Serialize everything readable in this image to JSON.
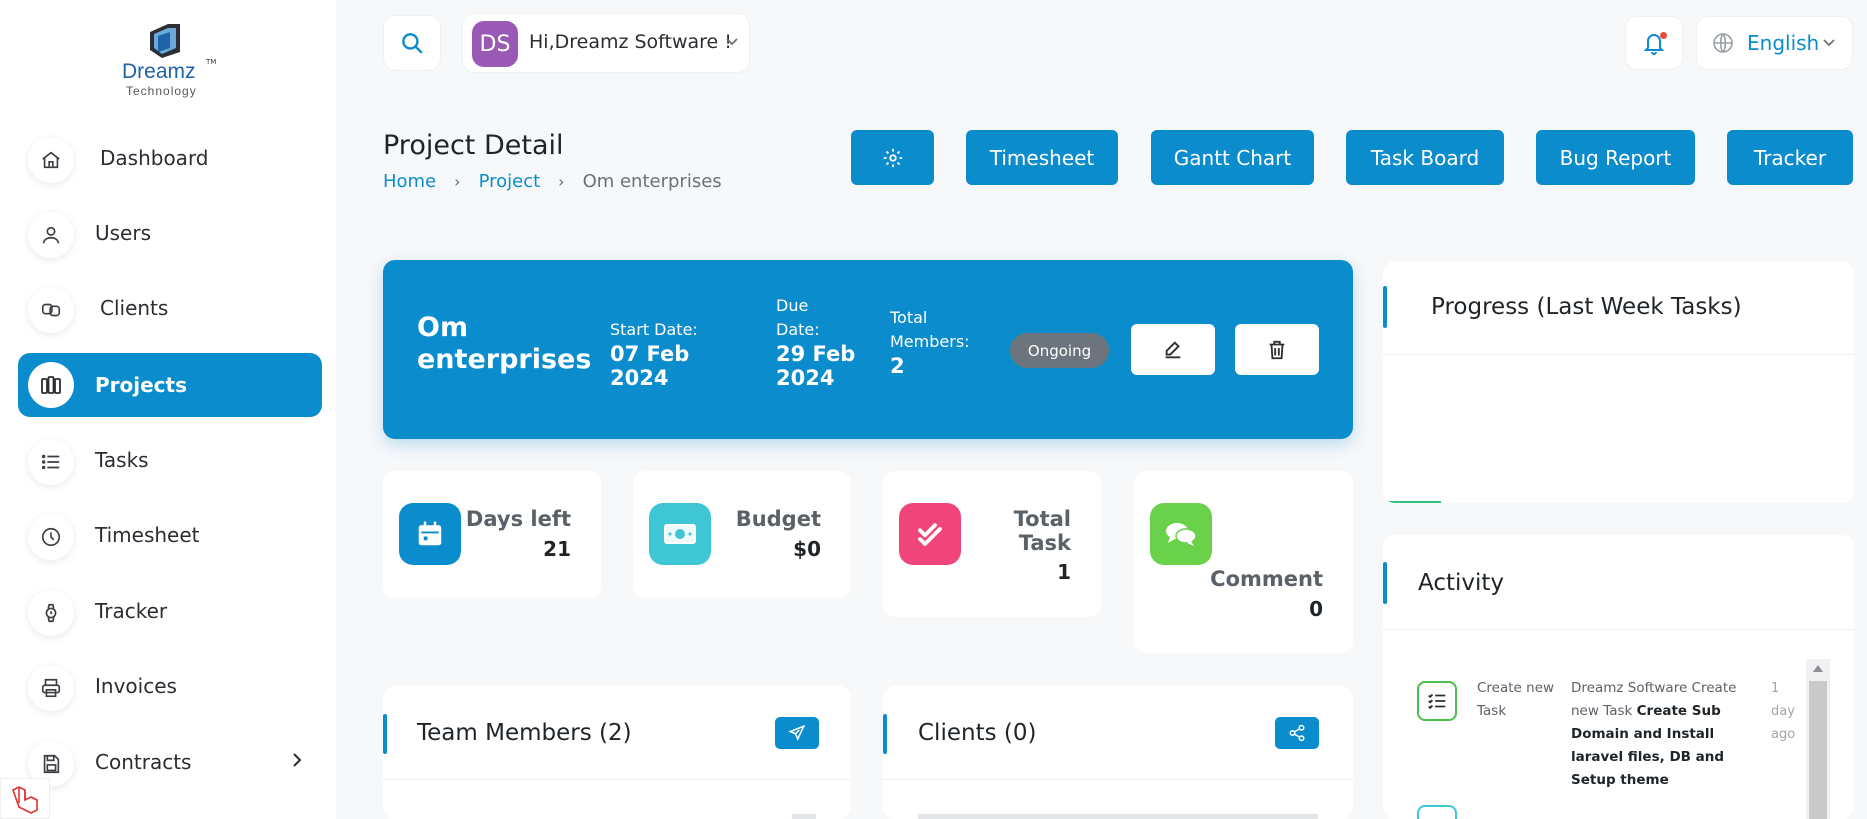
{
  "brand": {
    "name": "Dreamz",
    "tm": "TM",
    "sub": "Technology"
  },
  "sidebar": {
    "items": [
      {
        "label": "Dashboard",
        "icon": "home-icon"
      },
      {
        "label": "Users",
        "icon": "user-icon"
      },
      {
        "label": "Clients",
        "icon": "clients-icon"
      },
      {
        "label": "Projects",
        "icon": "projects-icon",
        "active": true
      },
      {
        "label": "Tasks",
        "icon": "list-icon"
      },
      {
        "label": "Timesheet",
        "icon": "clock-icon"
      },
      {
        "label": "Tracker",
        "icon": "watch-icon"
      },
      {
        "label": "Invoices",
        "icon": "printer-icon"
      },
      {
        "label": "Contracts",
        "icon": "save-icon"
      }
    ]
  },
  "topbar": {
    "avatar_initials": "DS",
    "greeting": "Hi,Dreamz Software !",
    "language": "English"
  },
  "page": {
    "title": "Project Detail",
    "breadcrumb": [
      "Home",
      "Project",
      "Om enterprises"
    ],
    "buttons": {
      "timesheet": "Timesheet",
      "gantt": "Gantt Chart",
      "task_board": "Task Board",
      "bug_report": "Bug Report",
      "tracker": "Tracker"
    }
  },
  "project": {
    "name": "Om enterprises",
    "start_label": "Start Date:",
    "start_date": "07 Feb 2024",
    "due_label": "Due Date:",
    "due_date": "29 Feb 2024",
    "members_label": "Total Members:",
    "members": "2",
    "status": "Ongoing"
  },
  "stats": {
    "days_left": {
      "label": "Days left",
      "value": "21"
    },
    "budget": {
      "label": "Budget",
      "value": "$0"
    },
    "total_task": {
      "label": "Total Task",
      "value": "1"
    },
    "comment": {
      "label": "Comment",
      "value": "0"
    }
  },
  "cards": {
    "progress_title": "Progress (Last Week Tasks)",
    "activity_title": "Activity",
    "team_title": "Team Members (2)",
    "clients_title": "Clients (0)"
  },
  "activity": [
    {
      "type": "Create new Task",
      "desc_prefix": "Dreamz Software Create new Task ",
      "desc_bold": "Create Sub Domain and Install laravel files, DB and Setup theme",
      "time": "1 day ago"
    }
  ],
  "colors": {
    "accent": "#0b8ccc",
    "status_badge": "#6c757d",
    "days_icon": "#0b8ccc",
    "budget_icon": "#3ec6d4",
    "task_icon": "#f0457a",
    "comment_icon": "#6ad14a"
  }
}
